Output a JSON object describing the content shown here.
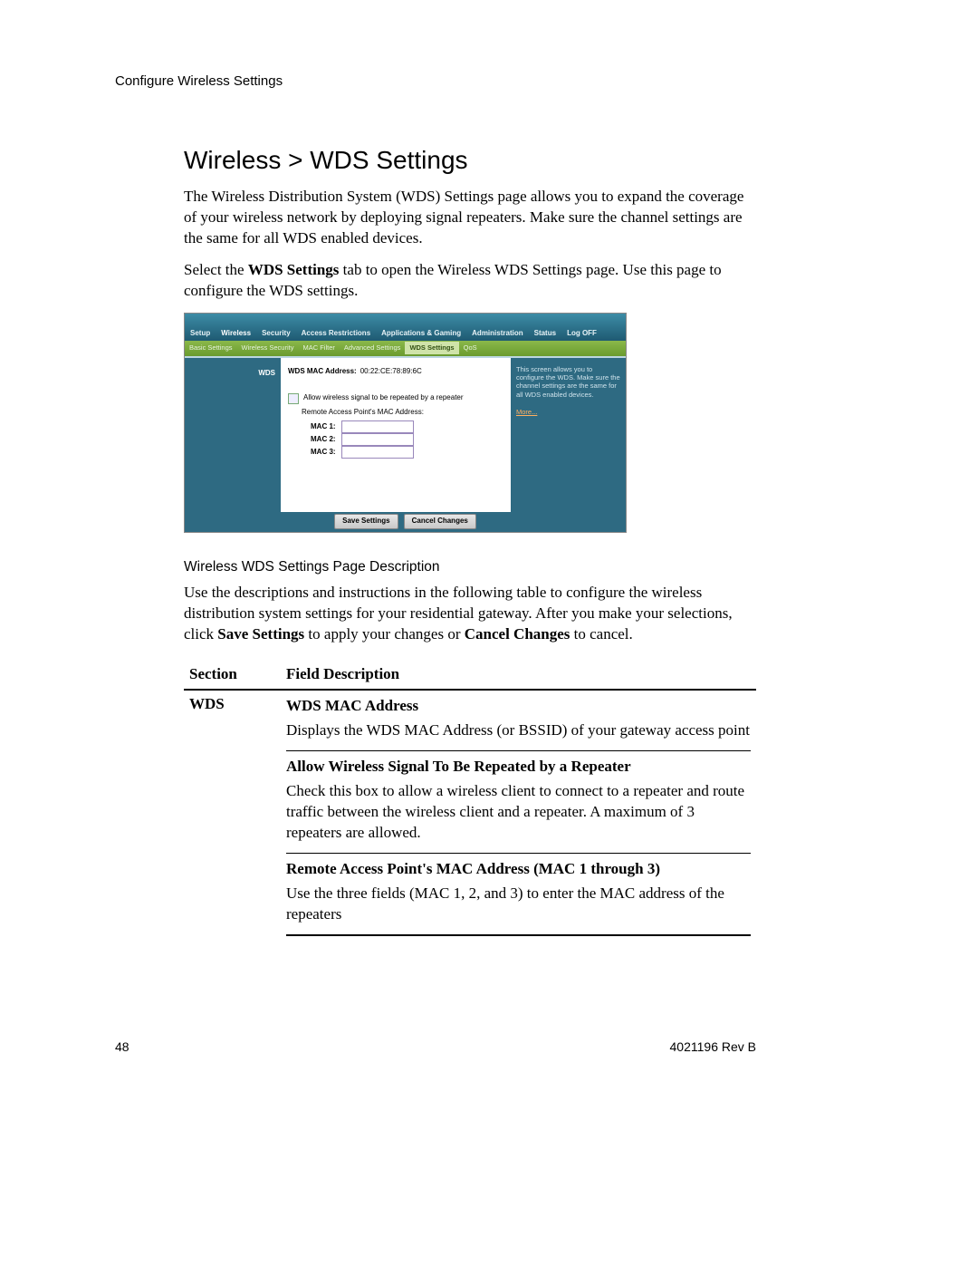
{
  "running_head": "Configure Wireless Settings",
  "title": "Wireless > WDS Settings",
  "intro1": "The Wireless Distribution System (WDS) Settings page allows you to expand the coverage of your wireless network by deploying signal repeaters.  Make sure the channel settings are the same for all WDS enabled devices.",
  "intro2_a": "Select the ",
  "intro2_b": "WDS Settings",
  "intro2_c": " tab to open the Wireless WDS Settings page. Use this page to configure the WDS settings.",
  "router": {
    "tabs": [
      "Setup",
      "Wireless",
      "Security",
      "Access\nRestrictions",
      "Applications\n& Gaming",
      "Administration",
      "Status",
      "Log OFF"
    ],
    "tabs_active_index": 1,
    "subtabs": [
      "Basic Settings",
      "Wireless Security",
      "MAC Filter",
      "Advanced Settings",
      "WDS Settings",
      "QoS"
    ],
    "subtabs_active_index": 4,
    "left_label": "WDS",
    "mac_label": "WDS MAC Address:",
    "mac_value": "00:22:CE:78:89:6C",
    "allow_label": "Allow wireless signal to be repeated by a repeater",
    "remote_label": "Remote Access Point's MAC Address:",
    "mac1": "MAC 1:",
    "mac2": "MAC 2:",
    "mac3": "MAC 3:",
    "help_text": "This screen allows you to configure the WDS. Make sure the channel settings are the same for all WDS enabled devices.",
    "help_more": "More...",
    "save_btn": "Save Settings",
    "cancel_btn": "Cancel Changes"
  },
  "subhead": "Wireless WDS Settings Page Description",
  "desc1_a": "Use the descriptions and instructions in the following table to configure the wireless distribution system settings for your residential gateway. After you make your selections, click ",
  "desc1_b": "Save Settings",
  "desc1_c": " to apply your changes or ",
  "desc1_d": "Cancel Changes",
  "desc1_e": " to cancel.",
  "table": {
    "headers": [
      "Section",
      "Field Description"
    ],
    "section": "WDS",
    "fields": [
      {
        "title": "WDS MAC Address",
        "text": "Displays the WDS MAC Address (or BSSID) of your gateway access point"
      },
      {
        "title": "Allow Wireless Signal To Be Repeated by a Repeater",
        "text": "Check this box to allow a wireless client to connect to a repeater and route traffic between the wireless client and a repeater. A maximum of 3 repeaters are allowed."
      },
      {
        "title": "Remote Access Point's MAC Address (MAC 1 through 3)",
        "text": "Use the three fields (MAC 1, 2, and 3) to enter the MAC address of the repeaters"
      }
    ]
  },
  "footer": {
    "page": "48",
    "rev": "4021196 Rev B"
  }
}
